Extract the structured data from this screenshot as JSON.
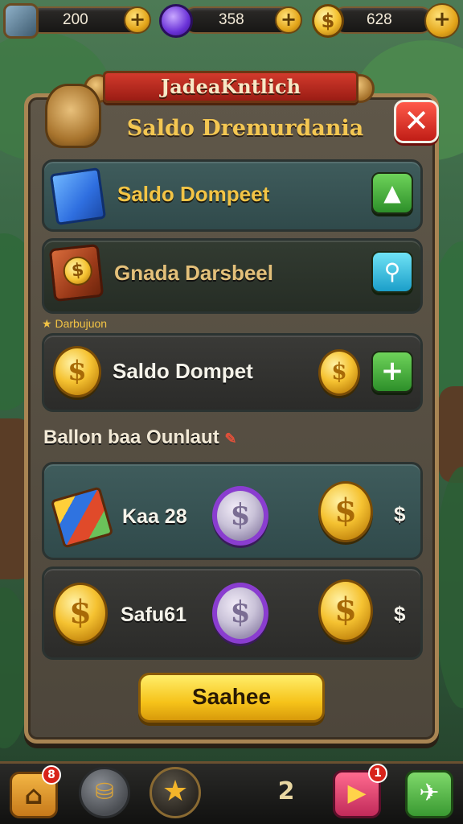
{
  "topbar": {
    "resources": [
      {
        "icon": "crate-icon",
        "value": "200"
      },
      {
        "icon": "purple-orb-icon",
        "value": "358"
      },
      {
        "icon": "gold-coin-icon",
        "value": "628"
      }
    ]
  },
  "dialog": {
    "banner": "JadeaKntlich",
    "title": "Saldo Dremurdania",
    "rows": [
      {
        "label": "Saldo Dompeet",
        "icon": "blue-book-icon",
        "action_icon": "up-arrow-icon"
      },
      {
        "label": "Gnada Darsbeel",
        "icon": "coin-chest-icon",
        "action_icon": "key-icon"
      }
    ],
    "small_caption": "Darbujuon",
    "wallet_row": {
      "label": "Saldo Dompet",
      "action_icon": "plus-icon"
    },
    "section_heading": "Ballon baa Ounlaut",
    "balance_rows": [
      {
        "label": "Kaa 28",
        "currency": "$"
      },
      {
        "label": "Safu61",
        "currency": "$"
      }
    ],
    "primary_button": "Saahee"
  },
  "bottom_nav": {
    "items": [
      {
        "icon": "home-icon",
        "badge": "8"
      },
      {
        "icon": "bag-icon",
        "badge": ""
      },
      {
        "icon": "star-icon",
        "badge": ""
      },
      {
        "icon": "trophy-icon",
        "label": "2",
        "badge": ""
      },
      {
        "icon": "play-store-icon",
        "badge": "1"
      },
      {
        "icon": "airplane-icon",
        "badge": ""
      }
    ]
  },
  "colors": {
    "panel_border": "#a98553",
    "title_gold": "#f3c445",
    "close_red": "#d8231a",
    "action_green": "#2d8f2a",
    "button_yellow": "#f6c31a"
  }
}
